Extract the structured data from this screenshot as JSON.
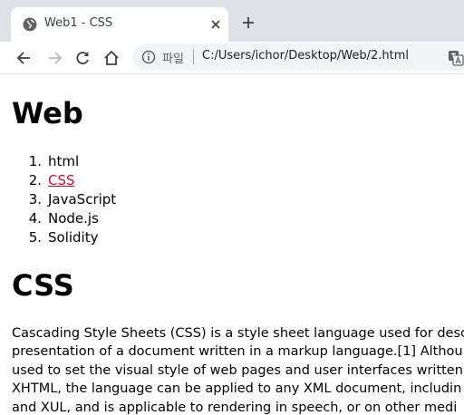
{
  "browser": {
    "tab_title": "Web1 - CSS",
    "scheme_label": "파일",
    "url": "C:/Users/ichor/Desktop/Web/2.html"
  },
  "page": {
    "heading": "Web",
    "items": [
      {
        "num": "1.",
        "label": "html",
        "link": false
      },
      {
        "num": "2.",
        "label": "CSS",
        "link": true
      },
      {
        "num": "3.",
        "label": "JavaScript",
        "link": false
      },
      {
        "num": "4.",
        "label": "Node.js",
        "link": false
      },
      {
        "num": "5.",
        "label": "Solidity",
        "link": false
      }
    ],
    "subheading": "CSS",
    "paragraph_lines": [
      "Cascading Style Sheets (CSS) is a style sheet language used for desc",
      "presentation of a document written in a markup language.[1] Althou",
      "used to set the visual style of web pages and user interfaces written",
      "XHTML, the language can be applied to any XML document, includin",
      "and XUL, and is applicable to rendering in speech, or on other medi"
    ]
  },
  "colors": {
    "link": "#c8102e",
    "tabstrip": "#dee1e6",
    "omnibox": "#f1f3f4"
  }
}
